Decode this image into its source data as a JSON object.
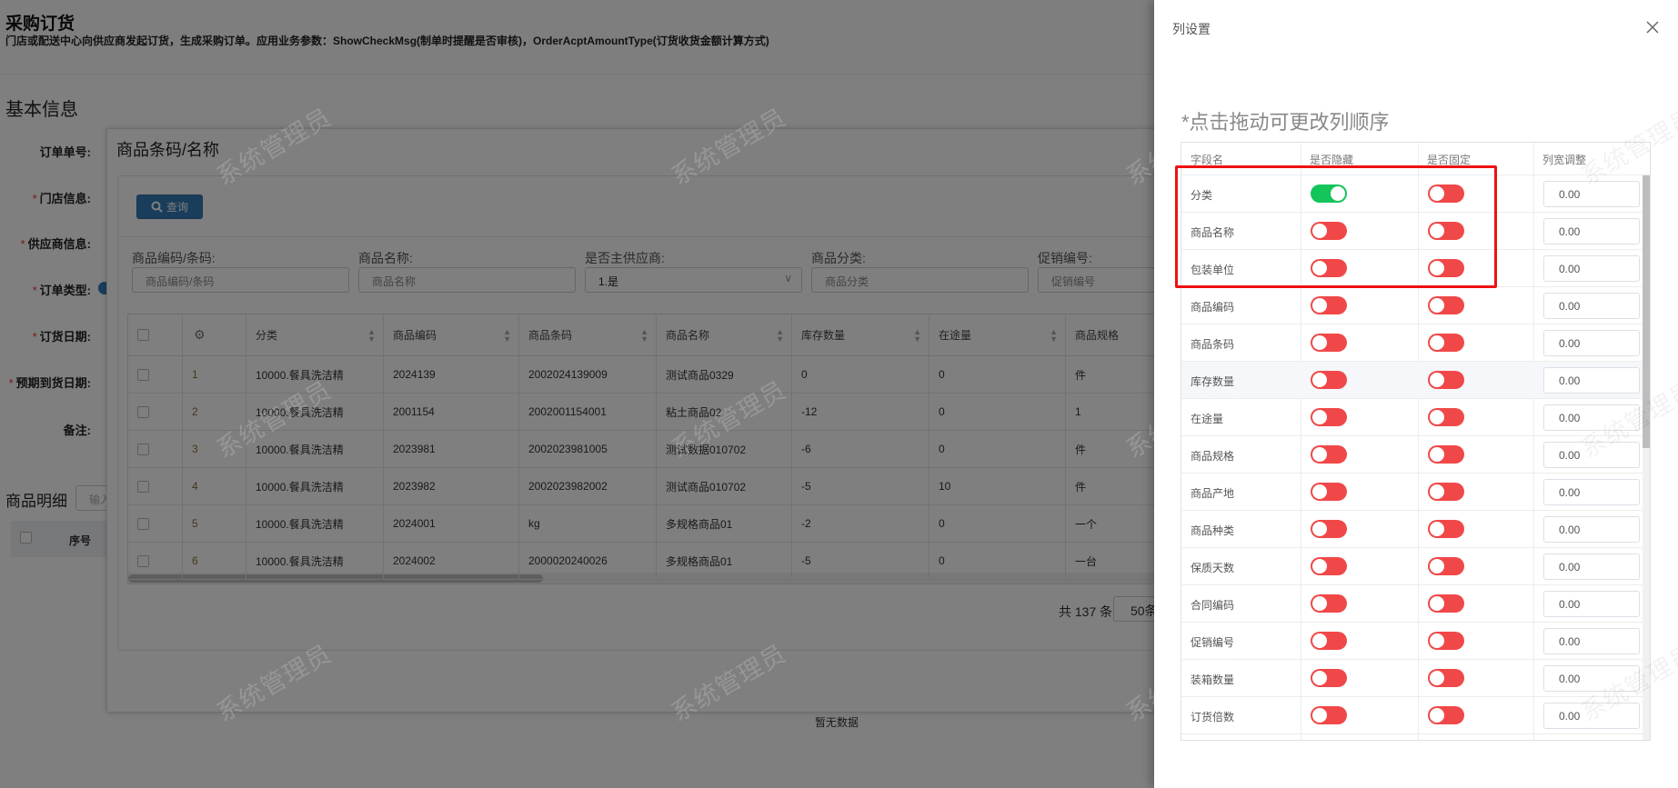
{
  "page": {
    "title": "采购订货",
    "description": "门店或配送中心向供应商发起订货，生成采购订单。应用业务参数：ShowCheckMsg(制单时提醒是否审核)，OrderAcptAmountType(订货收货金额计算方式)",
    "section": "基本信息",
    "form_labels": [
      {
        "label": "订单单号:",
        "required": false
      },
      {
        "label": "门店信息:",
        "required": true
      },
      {
        "label": "供应商信息:",
        "required": true
      },
      {
        "label": "订单类型:",
        "required": true
      },
      {
        "label": "订货日期:",
        "required": true
      },
      {
        "label": "预期到货日期:",
        "required": true
      },
      {
        "label": "备注:",
        "required": false
      }
    ],
    "required_mark": "*",
    "detail_title": "商品明细",
    "detail_input_placeholder": "输入",
    "detail_col_index": "序号",
    "no_data": "暂无数据"
  },
  "dialog": {
    "title": "商品条码/名称",
    "query_button": "查询",
    "filters": [
      {
        "label": "商品编码/条码:",
        "placeholder": "商品编码/条码"
      },
      {
        "label": "商品名称:",
        "placeholder": "商品名称"
      },
      {
        "label": "是否主供应商:",
        "value": "1.是"
      },
      {
        "label": "商品分类:",
        "placeholder": "商品分类"
      },
      {
        "label": "促销编号:",
        "placeholder": "促销编号"
      }
    ],
    "columns": [
      "分类",
      "商品编码",
      "商品条码",
      "商品名称",
      "库存数量",
      "在途量",
      "商品规格"
    ],
    "rows": [
      [
        "1",
        "10000.餐具洗洁精",
        "2024139",
        "2002024139009",
        "测试商品0329",
        "0",
        "0",
        "件"
      ],
      [
        "2",
        "10000.餐具洗洁精",
        "2001154",
        "2002001154001",
        "粘土商品02",
        "-12",
        "0",
        "1"
      ],
      [
        "3",
        "10000.餐具洗洁精",
        "2023981",
        "2002023981005",
        "测试数据010702",
        "-6",
        "0",
        "件"
      ],
      [
        "4",
        "10000.餐具洗洁精",
        "2023982",
        "2002023982002",
        "测试商品010702",
        "-5",
        "10",
        "件"
      ],
      [
        "5",
        "10000.餐具洗洁精",
        "2024001",
        "kg",
        "多规格商品01",
        "-2",
        "0",
        "一个"
      ],
      [
        "6",
        "10000.餐具洗洁精",
        "2024002",
        "2000020240026",
        "多规格商品01",
        "-5",
        "0",
        "一台"
      ]
    ],
    "total": "共 137 条",
    "page_size": "50条"
  },
  "drawer": {
    "title": "列设置",
    "hint": "*点击拖动可更改列顺序",
    "headers": [
      "字段名",
      "是否隐藏",
      "是否固定",
      "列宽调整"
    ],
    "rows": [
      {
        "name": "分类",
        "hidden": true,
        "fixed": false,
        "width": "0.00"
      },
      {
        "name": "商品名称",
        "hidden": false,
        "fixed": false,
        "width": "0.00"
      },
      {
        "name": "包装单位",
        "hidden": false,
        "fixed": false,
        "width": "0.00"
      },
      {
        "name": "商品编码",
        "hidden": false,
        "fixed": false,
        "width": "0.00"
      },
      {
        "name": "商品条码",
        "hidden": false,
        "fixed": false,
        "width": "0.00"
      },
      {
        "name": "库存数量",
        "hidden": false,
        "fixed": false,
        "width": "0.00"
      },
      {
        "name": "在途量",
        "hidden": false,
        "fixed": false,
        "width": "0.00"
      },
      {
        "name": "商品规格",
        "hidden": false,
        "fixed": false,
        "width": "0.00"
      },
      {
        "name": "商品产地",
        "hidden": false,
        "fixed": false,
        "width": "0.00"
      },
      {
        "name": "商品种类",
        "hidden": false,
        "fixed": false,
        "width": "0.00"
      },
      {
        "name": "保质天数",
        "hidden": false,
        "fixed": false,
        "width": "0.00"
      },
      {
        "name": "合同编码",
        "hidden": false,
        "fixed": false,
        "width": "0.00"
      },
      {
        "name": "促销编号",
        "hidden": false,
        "fixed": false,
        "width": "0.00"
      },
      {
        "name": "装箱数量",
        "hidden": false,
        "fixed": false,
        "width": "0.00"
      },
      {
        "name": "订货倍数",
        "hidden": false,
        "fixed": false,
        "width": "0.00"
      }
    ]
  },
  "watermark": "系统管理员",
  "colors": {
    "toggle_on": "#13c55a",
    "toggle_off": "#f04848",
    "primary": "#337ab7",
    "highlight": "#ee1111"
  }
}
